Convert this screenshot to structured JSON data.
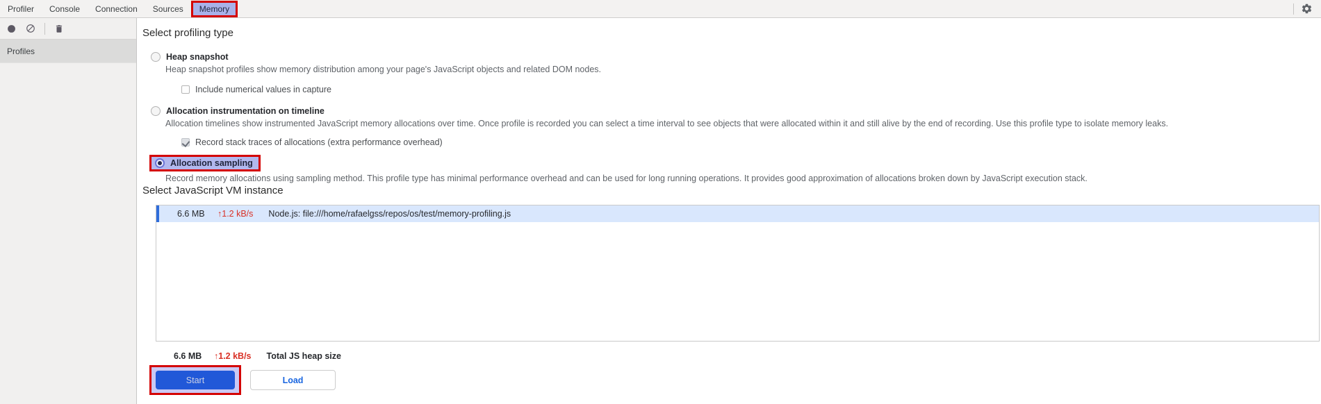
{
  "tabs": {
    "items": [
      {
        "label": "Profiler",
        "active": false
      },
      {
        "label": "Console",
        "active": false
      },
      {
        "label": "Connection",
        "active": false
      },
      {
        "label": "Sources",
        "active": false
      },
      {
        "label": "Memory",
        "active": true
      }
    ],
    "settings_icon": "gear-icon"
  },
  "toolbar": {
    "icons": [
      "record-icon",
      "clear-icon",
      "trash-icon"
    ]
  },
  "sidebar": {
    "header": "Profiles"
  },
  "profiling": {
    "heading": "Select profiling type",
    "options": [
      {
        "label": "Heap snapshot",
        "selected": false,
        "description": "Heap snapshot profiles show memory distribution among your page's JavaScript objects and related DOM nodes.",
        "checkbox": {
          "label": "Include numerical values in capture",
          "checked": false,
          "disabled": false
        }
      },
      {
        "label": "Allocation instrumentation on timeline",
        "selected": false,
        "description": "Allocation timelines show instrumented JavaScript memory allocations over time. Once profile is recorded you can select a time interval to see objects that were allocated within it and still alive by the end of recording. Use this profile type to isolate memory leaks.",
        "checkbox": {
          "label": "Record stack traces of allocations (extra performance overhead)",
          "checked": true,
          "disabled": true
        }
      },
      {
        "label": "Allocation sampling",
        "selected": true,
        "annotated": true,
        "description": "Record memory allocations using sampling method. This profile type has minimal performance overhead and can be used for long running operations. It provides good approximation of allocations broken down by JavaScript execution stack."
      }
    ]
  },
  "vm": {
    "heading": "Select JavaScript VM instance",
    "instances": [
      {
        "size": "6.6 MB",
        "rate": "↑1.2 kB/s",
        "name": "Node.js: file:///home/rafaelgss/repos/os/test/memory-profiling.js",
        "selected": true
      }
    ],
    "total": {
      "size": "6.6 MB",
      "rate": "↑1.2 kB/s",
      "label": "Total JS heap size"
    }
  },
  "actions": {
    "start_label": "Start",
    "load_label": "Load"
  },
  "colors": {
    "annotation_red": "#d40000",
    "highlight_lavender": "#a9b1e9",
    "selected_row_blue": "#d9e7fd",
    "row_accent_blue": "#2f6ddb",
    "rate_red": "#d93025",
    "start_button_blue": "#2158d8",
    "load_text_blue": "#1a66e0"
  }
}
